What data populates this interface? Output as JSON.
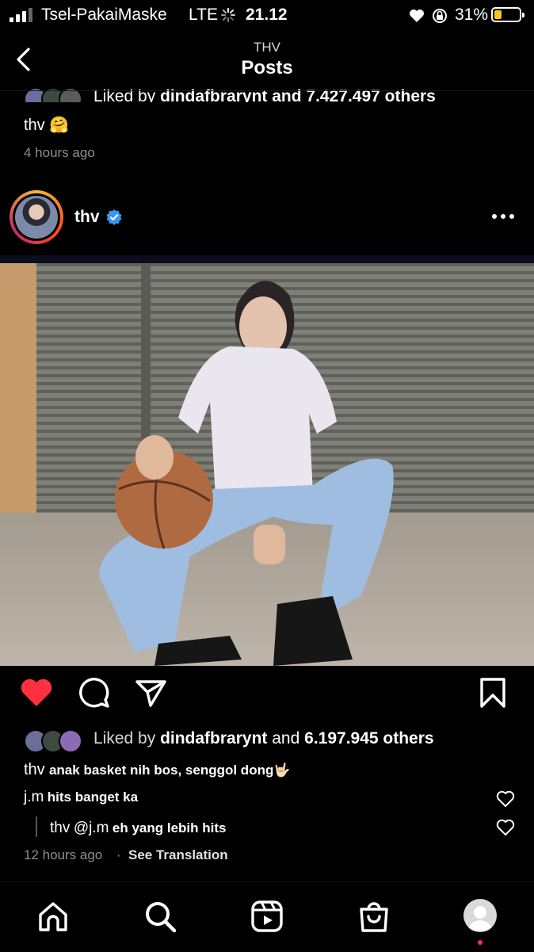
{
  "status_bar": {
    "carrier": "Tsel-PakaiMaske",
    "network": "LTE",
    "time": "21.12",
    "battery": "31%",
    "battery_level": 0.31
  },
  "header": {
    "subtitle": "THV",
    "title": "Posts"
  },
  "previous_post": {
    "liked_by_prefix": "Liked by",
    "liked_by_user": "dindafbrarynt",
    "liked_by_suffix": "and 7.427.497 others",
    "caption_user": "thv",
    "caption_emoji": "🤗",
    "time": "4 hours ago"
  },
  "post": {
    "username": "thv",
    "liked_by_prefix": "Liked by",
    "liked_by_user": "dindafbrarynt",
    "liked_by_middle": "and",
    "liked_by_count": "6.197.945 others",
    "caption_user": "thv",
    "caption_text": "anak basket nih bos, senggol dong🤟🏻",
    "comments": [
      {
        "user": "j.m",
        "text": "hits banget ka"
      }
    ],
    "reply": {
      "user": "thv",
      "mention": "@j.m",
      "text": "eh yang lebih hits"
    },
    "time": "12 hours ago",
    "separator": "·",
    "see_translation": "See Translation"
  },
  "icons": {
    "back": "chevron-left-icon",
    "more": "more-dots-icon",
    "verified": "verified-badge-icon",
    "like": "heart-filled-icon",
    "comment": "comment-bubble-icon",
    "share": "paper-plane-icon",
    "save": "bookmark-icon",
    "home": "home-icon",
    "search": "search-icon",
    "reels": "reels-icon",
    "shop": "shop-bag-icon",
    "profile": "profile-avatar-icon"
  },
  "colors": {
    "accent_like": "#ff3040",
    "verified": "#3897f0",
    "background": "#000000",
    "secondary_text": "#8e8e8e"
  }
}
